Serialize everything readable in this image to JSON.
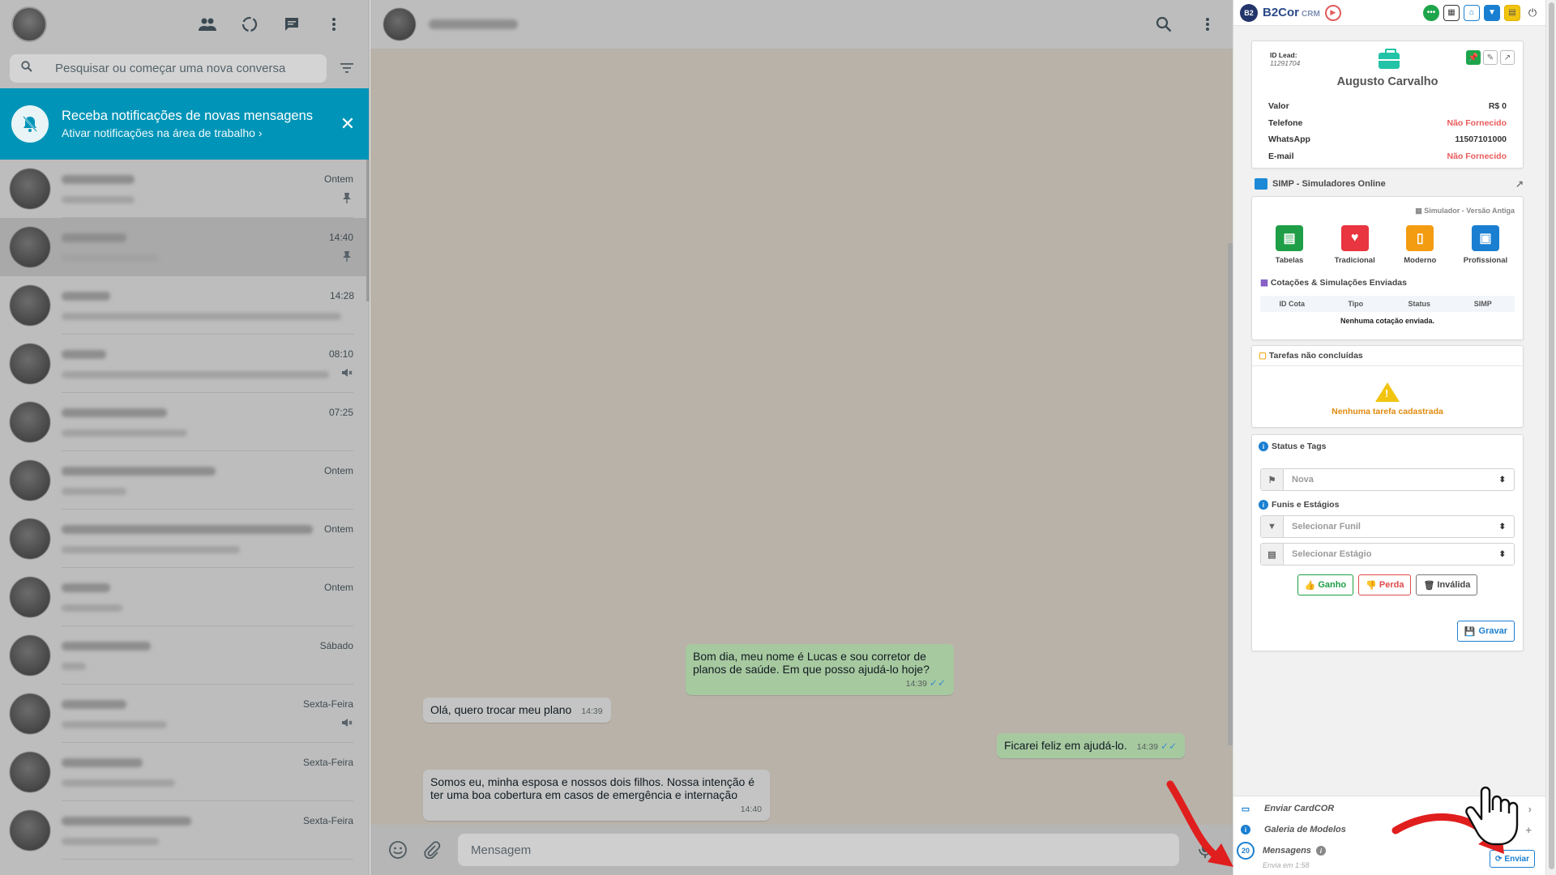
{
  "left": {
    "search_placeholder": "Pesquisar ou começar uma nova conversa",
    "notification": {
      "title": "Receba notificações de novas mensagens",
      "subtitle": "Ativar notificações na área de trabalho"
    },
    "chats": [
      {
        "time": "Ontem",
        "tag": "pin"
      },
      {
        "time": "14:40",
        "tag": "pin"
      },
      {
        "time": "14:28",
        "tag": ""
      },
      {
        "time": "08:10",
        "tag": "mute"
      },
      {
        "time": "07:25",
        "tag": ""
      },
      {
        "time": "Ontem",
        "tag": ""
      },
      {
        "time": "Ontem",
        "tag": ""
      },
      {
        "time": "Ontem",
        "tag": ""
      },
      {
        "time": "Sábado",
        "tag": ""
      },
      {
        "time": "Sexta-Feira",
        "tag": "mute"
      },
      {
        "time": "Sexta-Feira",
        "tag": ""
      },
      {
        "time": "Sexta-Feira",
        "tag": ""
      }
    ]
  },
  "chat": {
    "messages": [
      {
        "dir": "out",
        "text": "Bom dia, meu nome é Lucas e sou corretor de planos de saúde. Em que posso ajudá-lo hoje?",
        "time": "14:39"
      },
      {
        "dir": "in",
        "text": "Olá, quero trocar meu plano",
        "time": "14:39"
      },
      {
        "dir": "out",
        "text": "Ficarei feliz em ajudá-lo.",
        "time": "14:39"
      },
      {
        "dir": "in",
        "text": "Somos eu, minha esposa e nossos dois filhos. Nossa intenção é ter uma boa cobertura em casos de emergência e internação",
        "time": "14:40"
      }
    ],
    "composer_placeholder": "Mensagem"
  },
  "crm": {
    "brand": "B2Cor",
    "brand_sub": "CRM",
    "lead": {
      "id_label": "ID Lead:",
      "id_value": "11291704",
      "name": "Augusto Carvalho",
      "rows": [
        {
          "label": "Valor",
          "value": "R$ 0",
          "missing": false
        },
        {
          "label": "Telefone",
          "value": "Não Fornecido",
          "missing": true
        },
        {
          "label": "WhatsApp",
          "value": "11507101000",
          "missing": false
        },
        {
          "label": "E-mail",
          "value": "Não Fornecido",
          "missing": true
        }
      ]
    },
    "simp": {
      "title": "SIMP - Simuladores Online",
      "old_version": "Simulador - Versão Antiga",
      "tiles": [
        {
          "label": "Tabelas",
          "color": "#1e9e46"
        },
        {
          "label": "Tradicional",
          "color": "#e8353f"
        },
        {
          "label": "Moderno",
          "color": "#f39c12"
        },
        {
          "label": "Profissional",
          "color": "#1a7fd1"
        }
      ],
      "quotes_title": "Cotações & Simulações Enviadas",
      "quotes_cols": [
        "ID Cota",
        "Tipo",
        "Status",
        "SIMP"
      ],
      "quotes_empty": "Nenhuma cotação enviada."
    },
    "tasks": {
      "title": "Tarefas não concluídas",
      "empty": "Nenhuma tarefa cadastrada"
    },
    "status": {
      "title": "Status e Tags",
      "status_value": "Nova",
      "funnels_title": "Funis e Estágios",
      "funnel_placeholder": "Selecionar Funil",
      "stage_placeholder": "Selecionar Estágio",
      "won": "Ganho",
      "lost": "Perda",
      "invalid": "Inválida",
      "save": "Gravar"
    },
    "bottom": {
      "send_card": "Enviar CardCOR",
      "gallery": "Galeria de Modelos",
      "messages": "Mensagens",
      "messages_count": "20",
      "send_in": "Envia em 1:58",
      "send": "Enviar"
    }
  }
}
